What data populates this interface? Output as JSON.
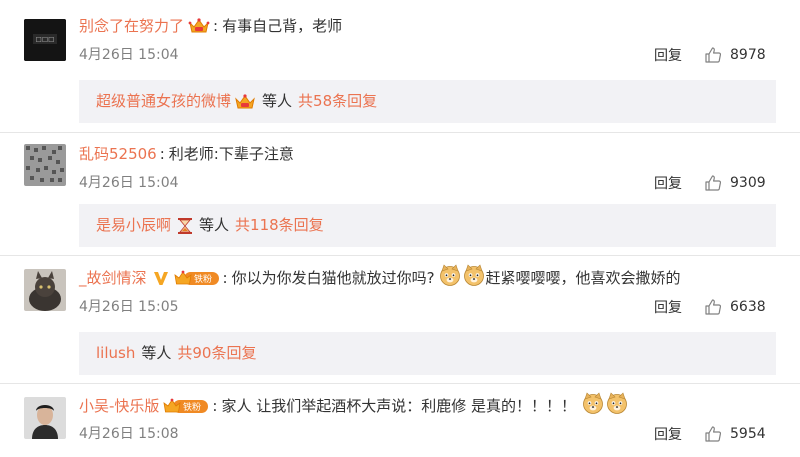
{
  "colors": {
    "link": "#eb7350",
    "text": "#333333",
    "meta": "#808080",
    "reply_box_bg": "#f2f2f5"
  },
  "comments": [
    {
      "username": "别念了在努力了",
      "badges": [
        "crown-icon"
      ],
      "text": "有事自己背，老师",
      "time": "4月26日 15:04",
      "reply_label": "回复",
      "likes": "8978",
      "replies": {
        "name": "超级普通女孩的微博",
        "name_badge": "crown-icon",
        "etc": "等人",
        "total": "共58条回复"
      }
    },
    {
      "username": "乱码52506",
      "badges": [],
      "text": "利老师:下辈子注意",
      "time": "4月26日 15:04",
      "reply_label": "回复",
      "likes": "9309",
      "replies": {
        "name": "是易小辰啊",
        "name_badge": "hourglass-icon",
        "etc": "等人",
        "total": "共118条回复"
      }
    },
    {
      "username": "_故剑情深",
      "badges": [
        "verified-v-icon",
        "iron-fan-badge"
      ],
      "badge_text": "铁粉",
      "text_before": "你以为你发白猫他就放过你吗?",
      "text_after": "赶紧嘤嘤嘤，他喜欢会撒娇的",
      "time": "4月26日 15:05",
      "reply_label": "回复",
      "likes": "6638",
      "replies": {
        "name": "lilush",
        "etc": "等人",
        "total": "共90条回复"
      }
    },
    {
      "username": "小吴-快乐版",
      "badges": [
        "iron-fan-badge"
      ],
      "badge_text": "铁粉",
      "text": "家人 让我们举起酒杯大声说：利鹿修 是真的！！！！",
      "time": "4月26日 15:08",
      "reply_label": "回复",
      "likes": "5954"
    }
  ]
}
